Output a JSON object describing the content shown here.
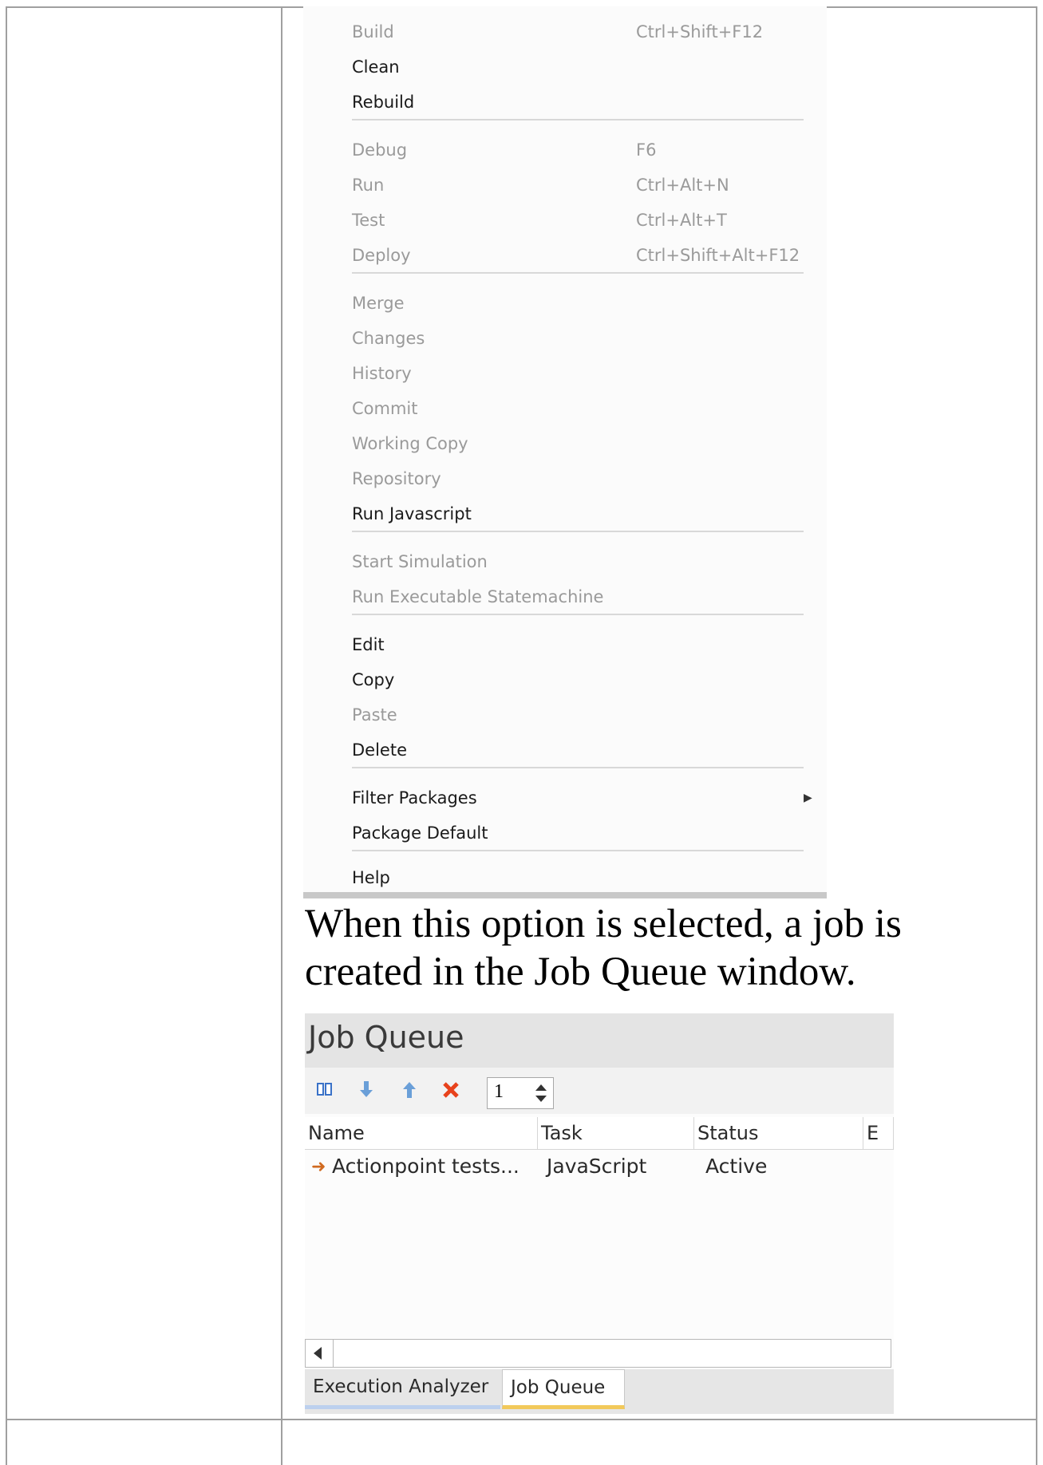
{
  "menu": {
    "items": [
      {
        "label": "Build",
        "shortcut": "Ctrl+Shift+F12",
        "enabled": false
      },
      {
        "label": "Clean",
        "shortcut": "",
        "enabled": true
      },
      {
        "label": "Rebuild",
        "shortcut": "",
        "enabled": true
      },
      {
        "label": "Debug",
        "shortcut": "F6",
        "enabled": false
      },
      {
        "label": "Run",
        "shortcut": "Ctrl+Alt+N",
        "enabled": false
      },
      {
        "label": "Test",
        "shortcut": "Ctrl+Alt+T",
        "enabled": false
      },
      {
        "label": "Deploy",
        "shortcut": "Ctrl+Shift+Alt+F12",
        "enabled": false
      },
      {
        "label": "Merge",
        "shortcut": "",
        "enabled": false
      },
      {
        "label": "Changes",
        "shortcut": "",
        "enabled": false
      },
      {
        "label": "History",
        "shortcut": "",
        "enabled": false
      },
      {
        "label": "Commit",
        "shortcut": "",
        "enabled": false
      },
      {
        "label": "Working Copy",
        "shortcut": "",
        "enabled": false
      },
      {
        "label": "Repository",
        "shortcut": "",
        "enabled": false
      },
      {
        "label": "Run Javascript",
        "shortcut": "",
        "enabled": true
      },
      {
        "label": "Start Simulation",
        "shortcut": "",
        "enabled": false
      },
      {
        "label": "Run Executable Statemachine",
        "shortcut": "",
        "enabled": false
      },
      {
        "label": "Edit",
        "shortcut": "",
        "enabled": true
      },
      {
        "label": "Copy",
        "shortcut": "",
        "enabled": true
      },
      {
        "label": "Paste",
        "shortcut": "",
        "enabled": false
      },
      {
        "label": "Delete",
        "shortcut": "",
        "enabled": true
      },
      {
        "label": "Filter Packages",
        "shortcut": "",
        "enabled": true,
        "submenu": true
      },
      {
        "label": "Package Default",
        "shortcut": "",
        "enabled": true
      },
      {
        "label": "Help",
        "shortcut": "",
        "enabled": true
      }
    ]
  },
  "paragraph": {
    "text": "When this option is selected, a job is created in the Job Queue window."
  },
  "job_queue": {
    "title": "Job Queue",
    "toolbar": {
      "icons": [
        "pause-icon",
        "move-down-icon",
        "move-up-icon",
        "delete-icon"
      ],
      "spin_value": "1"
    },
    "columns": [
      "Name",
      "Task",
      "Status",
      "E"
    ],
    "rows": [
      {
        "name": "Actionpoint tests...",
        "task": "JavaScript",
        "status": "Active"
      }
    ],
    "tabs": [
      "Execution Analyzer",
      "Job Queue"
    ],
    "active_tab": "Job Queue",
    "colors": {
      "row_arrow": "#d06a20",
      "delete_icon": "#e8421c",
      "arrow_icons": "#6a9fd8",
      "active_tab_accent": "#f2c95a"
    }
  }
}
